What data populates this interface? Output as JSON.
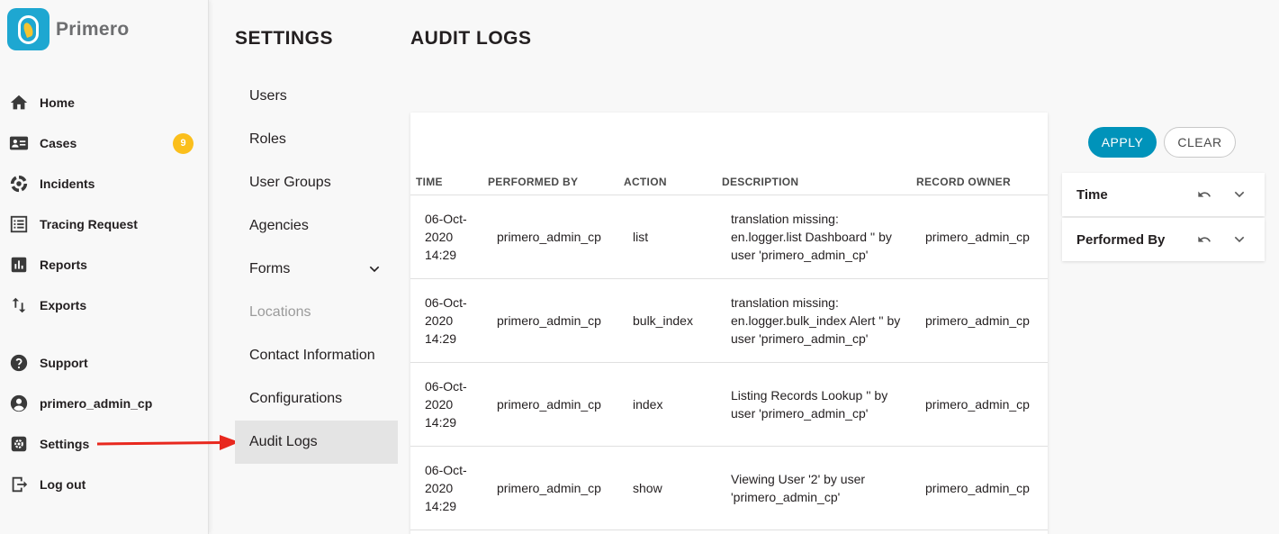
{
  "app": {
    "name": "Primero"
  },
  "nav": {
    "items": [
      {
        "label": "Home",
        "icon": "home-icon"
      },
      {
        "label": "Cases",
        "icon": "id-card-icon",
        "badge": "9"
      },
      {
        "label": "Incidents",
        "icon": "incident-icon"
      },
      {
        "label": "Tracing Request",
        "icon": "list-icon"
      },
      {
        "label": "Reports",
        "icon": "bar-chart-icon"
      },
      {
        "label": "Exports",
        "icon": "swap-vertical-icon"
      },
      {
        "label": "Support",
        "icon": "help-icon"
      },
      {
        "label": "primero_admin_cp",
        "icon": "account-icon"
      },
      {
        "label": "Settings",
        "icon": "gear-icon"
      },
      {
        "label": "Log out",
        "icon": "logout-icon"
      }
    ]
  },
  "settings": {
    "title": "SETTINGS",
    "menu": [
      {
        "label": "Users"
      },
      {
        "label": "Roles"
      },
      {
        "label": "User Groups"
      },
      {
        "label": "Agencies"
      },
      {
        "label": "Forms"
      },
      {
        "label": "Locations"
      },
      {
        "label": "Contact Information"
      },
      {
        "label": "Configurations"
      },
      {
        "label": "Audit Logs"
      }
    ]
  },
  "audit": {
    "title": "AUDIT LOGS",
    "columns": [
      "TIME",
      "PERFORMED BY",
      "ACTION",
      "DESCRIPTION",
      "RECORD OWNER"
    ],
    "rows": [
      {
        "time": "06-Oct-2020 14:29",
        "performed_by": "primero_admin_cp",
        "action": "list",
        "description": "translation missing: en.logger.list Dashboard '' by user 'primero_admin_cp'",
        "record_owner": "primero_admin_cp"
      },
      {
        "time": "06-Oct-2020 14:29",
        "performed_by": "primero_admin_cp",
        "action": "bulk_index",
        "description": "translation missing: en.logger.bulk_index Alert '' by user 'primero_admin_cp'",
        "record_owner": "primero_admin_cp"
      },
      {
        "time": "06-Oct-2020 14:29",
        "performed_by": "primero_admin_cp",
        "action": "index",
        "description": "Listing Records Lookup '' by user 'primero_admin_cp'",
        "record_owner": "primero_admin_cp"
      },
      {
        "time": "06-Oct-2020 14:29",
        "performed_by": "primero_admin_cp",
        "action": "show",
        "description": "Viewing User '2' by user 'primero_admin_cp'",
        "record_owner": "primero_admin_cp"
      }
    ]
  },
  "filters": {
    "apply_label": "APPLY",
    "clear_label": "CLEAR",
    "panels": [
      {
        "label": "Time"
      },
      {
        "label": "Performed By"
      }
    ]
  },
  "colors": {
    "accent": "#0093ba",
    "badge": "#fbbf1c",
    "annotation_arrow": "#e8281e"
  }
}
